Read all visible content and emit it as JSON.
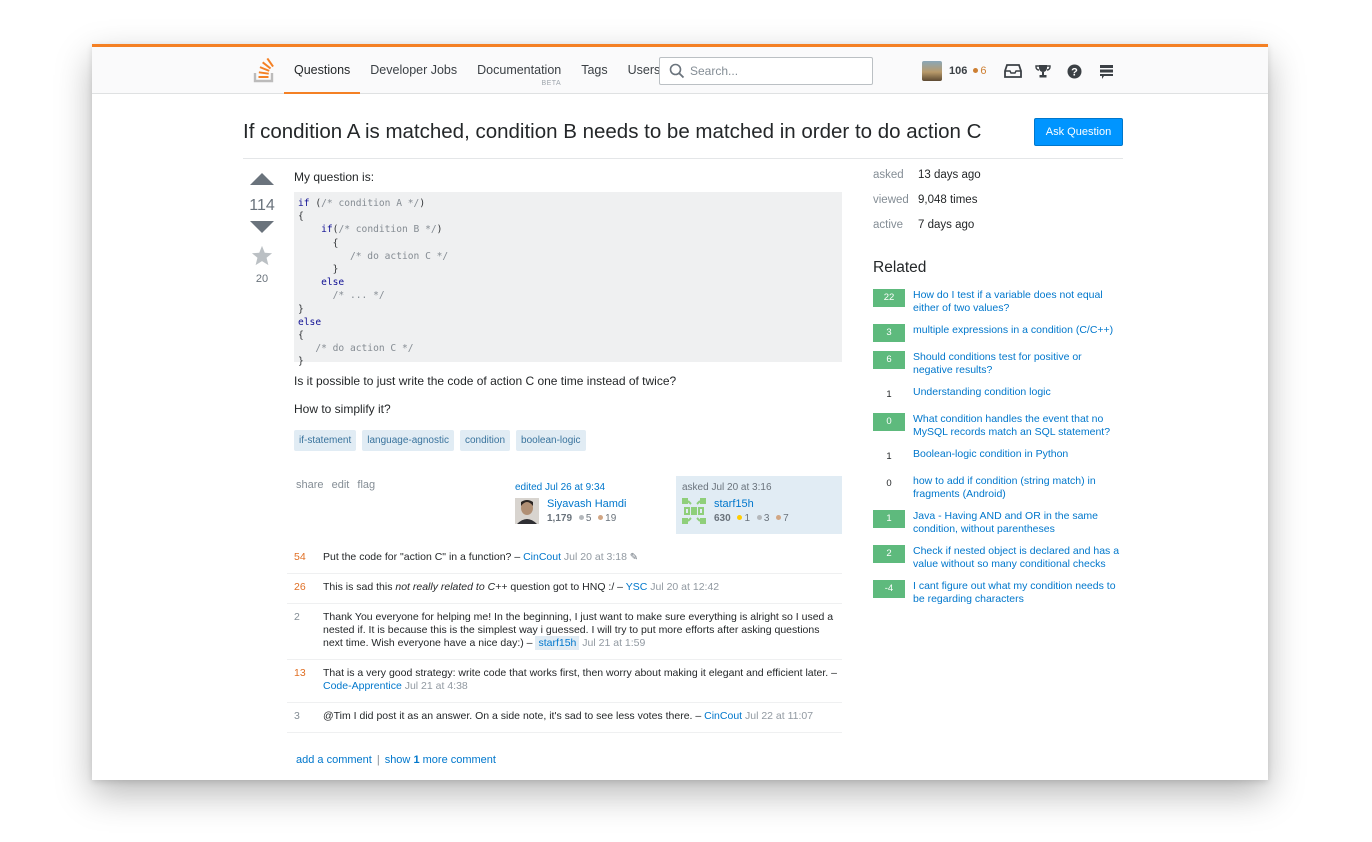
{
  "header": {
    "nav": [
      "Questions",
      "Developer Jobs",
      "Documentation",
      "Tags",
      "Users"
    ],
    "nav_beta": "BETA",
    "search_placeholder": "Search...",
    "reputation": "106",
    "bronze_badges": "6"
  },
  "question": {
    "title": "If condition A is matched, condition B needs to be matched in order to do action C",
    "ask_button": "Ask Question",
    "votes": "114",
    "favorites": "20",
    "intro": "My question is:",
    "code_lines": [
      {
        "kw": "if",
        "rest": " (",
        "cm": "/* condition A */",
        "tail": ")"
      },
      {
        "kw": "",
        "rest": "{",
        "cm": "",
        "tail": ""
      },
      {
        "kw": "    if",
        "rest": "(",
        "cm": "/* condition B */",
        "tail": ")"
      },
      {
        "kw": "",
        "rest": "      {",
        "cm": "",
        "tail": ""
      },
      {
        "kw": "",
        "rest": "         ",
        "cm": "/* do action C */",
        "tail": ""
      },
      {
        "kw": "",
        "rest": "      }",
        "cm": "",
        "tail": ""
      },
      {
        "kw": "    else",
        "rest": "",
        "cm": "",
        "tail": ""
      },
      {
        "kw": "",
        "rest": "      ",
        "cm": "/* ... */",
        "tail": ""
      },
      {
        "kw": "",
        "rest": "}",
        "cm": "",
        "tail": ""
      },
      {
        "kw": "else",
        "rest": "",
        "cm": "",
        "tail": ""
      },
      {
        "kw": "",
        "rest": "{",
        "cm": "",
        "tail": ""
      },
      {
        "kw": "",
        "rest": "   ",
        "cm": "/* do action C */",
        "tail": ""
      },
      {
        "kw": "",
        "rest": "}",
        "cm": "",
        "tail": ""
      }
    ],
    "paragraph2": "Is it possible to just write the code of action C one time instead of twice?",
    "paragraph3": "How to simplify it?",
    "tags": [
      "if-statement",
      "language-agnostic",
      "condition",
      "boolean-logic"
    ],
    "menu": [
      "share",
      "edit",
      "flag"
    ],
    "edited": {
      "time": "edited Jul 26 at 9:34",
      "name": "Siyavash Hamdi",
      "rep": "1,179",
      "silver": "5",
      "bronze": "19"
    },
    "asked": {
      "time": "asked Jul 20 at 3:16",
      "name": "starf15h",
      "rep": "630",
      "gold": "1",
      "silver": "3",
      "bronze": "7"
    }
  },
  "comments": [
    {
      "score": "54",
      "before": "Put the code for \"action C\" in a function? – ",
      "em": "",
      "after": "",
      "user": "CinCout",
      "date": "Jul 20 at 3:18",
      "hot": true,
      "edited": "✎"
    },
    {
      "score": "26",
      "before": "This is sad this ",
      "em": "not really related to C++",
      "after": " question got to HNQ :/ – ",
      "user": "YSC",
      "date": "Jul 20 at 12:42",
      "hot": true,
      "edited": ""
    },
    {
      "score": "2",
      "before": "Thank You everyone for helping me! In the beginning, I just want to make sure everything is alright so I used a nested if. It is because this is the simplest way i guessed. I will try to put more efforts after asking questions next time. Wish everyone have a nice day:) – ",
      "em": "",
      "after": "",
      "user": "starf15h",
      "date": "Jul 21 at 1:59",
      "hot": false,
      "edited": ""
    },
    {
      "score": "13",
      "before": "That is a very good strategy: write code that works first, then worry about making it elegant and efficient later. – ",
      "em": "",
      "after": "",
      "user": "Code-Apprentice",
      "date": "Jul 21 at 4:38",
      "hot": true,
      "edited": ""
    },
    {
      "score": "3",
      "before": "@Tim I did post it as an answer. On a side note, it's sad to see less votes there. – ",
      "em": "",
      "after": "",
      "user": "CinCout",
      "date": "Jul 22 at 11:07",
      "hot": false,
      "edited": ""
    }
  ],
  "comment_actions": {
    "add": "add a comment",
    "show_before": "show ",
    "show_count": "1",
    "show_after": " more comment"
  },
  "stats": [
    {
      "label": "asked",
      "value": "13 days ago"
    },
    {
      "label": "viewed",
      "value": "9,048 times"
    },
    {
      "label": "active",
      "value": "7 days ago"
    }
  ],
  "related_heading": "Related",
  "related": [
    {
      "score": "22",
      "accepted": true,
      "title": "How do I test if a variable does not equal either of two values?"
    },
    {
      "score": "3",
      "accepted": true,
      "title": "multiple expressions in a condition (C/C++)"
    },
    {
      "score": "6",
      "accepted": true,
      "title": "Should conditions test for positive or negative results?"
    },
    {
      "score": "1",
      "accepted": false,
      "title": "Understanding condition logic"
    },
    {
      "score": "0",
      "accepted": true,
      "title": "What condition handles the event that no MySQL records match an SQL statement?"
    },
    {
      "score": "1",
      "accepted": false,
      "title": "Boolean-logic condition in Python"
    },
    {
      "score": "0",
      "accepted": false,
      "title": "how to add if condition (string match) in fragments (Android)"
    },
    {
      "score": "1",
      "accepted": true,
      "title": "Java - Having AND and OR in the same condition, without parentheses"
    },
    {
      "score": "2",
      "accepted": true,
      "title": "Check if nested object is declared and has a value without so many conditional checks"
    },
    {
      "score": "-4",
      "accepted": true,
      "title": "I cant figure out what my condition needs to be regarding characters"
    }
  ],
  "colors": {
    "accent": "#f48024",
    "link": "#0077cc",
    "accepted": "#5eba7d",
    "button": "#0095ff"
  }
}
